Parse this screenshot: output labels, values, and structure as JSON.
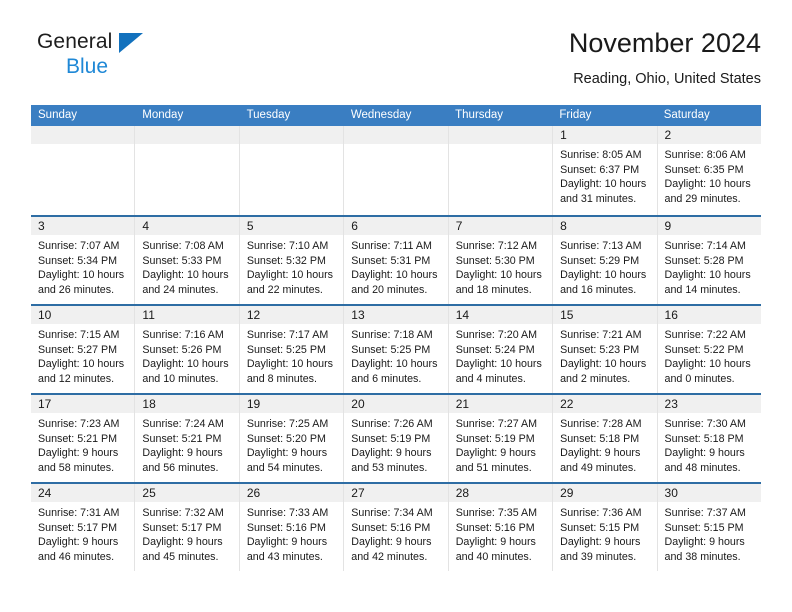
{
  "brand": {
    "name_part1": "General",
    "name_part2": "Blue",
    "triangle_color": "#1271bd",
    "blue_text_color": "#1f88d6"
  },
  "header": {
    "title": "November 2024",
    "subtitle": "Reading, Ohio, United States"
  },
  "colors": {
    "header_blue": "#3a7ec2",
    "week_separator": "#2e6da4",
    "day_strip": "#f0f0f0",
    "column_divider": "#e3e3e3"
  },
  "weekday_headers": [
    "Sunday",
    "Monday",
    "Tuesday",
    "Wednesday",
    "Thursday",
    "Friday",
    "Saturday"
  ],
  "weeks": [
    [
      {
        "day": "",
        "lines": []
      },
      {
        "day": "",
        "lines": []
      },
      {
        "day": "",
        "lines": []
      },
      {
        "day": "",
        "lines": []
      },
      {
        "day": "",
        "lines": []
      },
      {
        "day": "1",
        "lines": [
          "Sunrise: 8:05 AM",
          "Sunset: 6:37 PM",
          "Daylight: 10 hours",
          "and 31 minutes."
        ]
      },
      {
        "day": "2",
        "lines": [
          "Sunrise: 8:06 AM",
          "Sunset: 6:35 PM",
          "Daylight: 10 hours",
          "and 29 minutes."
        ]
      }
    ],
    [
      {
        "day": "3",
        "lines": [
          "Sunrise: 7:07 AM",
          "Sunset: 5:34 PM",
          "Daylight: 10 hours",
          "and 26 minutes."
        ]
      },
      {
        "day": "4",
        "lines": [
          "Sunrise: 7:08 AM",
          "Sunset: 5:33 PM",
          "Daylight: 10 hours",
          "and 24 minutes."
        ]
      },
      {
        "day": "5",
        "lines": [
          "Sunrise: 7:10 AM",
          "Sunset: 5:32 PM",
          "Daylight: 10 hours",
          "and 22 minutes."
        ]
      },
      {
        "day": "6",
        "lines": [
          "Sunrise: 7:11 AM",
          "Sunset: 5:31 PM",
          "Daylight: 10 hours",
          "and 20 minutes."
        ]
      },
      {
        "day": "7",
        "lines": [
          "Sunrise: 7:12 AM",
          "Sunset: 5:30 PM",
          "Daylight: 10 hours",
          "and 18 minutes."
        ]
      },
      {
        "day": "8",
        "lines": [
          "Sunrise: 7:13 AM",
          "Sunset: 5:29 PM",
          "Daylight: 10 hours",
          "and 16 minutes."
        ]
      },
      {
        "day": "9",
        "lines": [
          "Sunrise: 7:14 AM",
          "Sunset: 5:28 PM",
          "Daylight: 10 hours",
          "and 14 minutes."
        ]
      }
    ],
    [
      {
        "day": "10",
        "lines": [
          "Sunrise: 7:15 AM",
          "Sunset: 5:27 PM",
          "Daylight: 10 hours",
          "and 12 minutes."
        ]
      },
      {
        "day": "11",
        "lines": [
          "Sunrise: 7:16 AM",
          "Sunset: 5:26 PM",
          "Daylight: 10 hours",
          "and 10 minutes."
        ]
      },
      {
        "day": "12",
        "lines": [
          "Sunrise: 7:17 AM",
          "Sunset: 5:25 PM",
          "Daylight: 10 hours",
          "and 8 minutes."
        ]
      },
      {
        "day": "13",
        "lines": [
          "Sunrise: 7:18 AM",
          "Sunset: 5:25 PM",
          "Daylight: 10 hours",
          "and 6 minutes."
        ]
      },
      {
        "day": "14",
        "lines": [
          "Sunrise: 7:20 AM",
          "Sunset: 5:24 PM",
          "Daylight: 10 hours",
          "and 4 minutes."
        ]
      },
      {
        "day": "15",
        "lines": [
          "Sunrise: 7:21 AM",
          "Sunset: 5:23 PM",
          "Daylight: 10 hours",
          "and 2 minutes."
        ]
      },
      {
        "day": "16",
        "lines": [
          "Sunrise: 7:22 AM",
          "Sunset: 5:22 PM",
          "Daylight: 10 hours",
          "and 0 minutes."
        ]
      }
    ],
    [
      {
        "day": "17",
        "lines": [
          "Sunrise: 7:23 AM",
          "Sunset: 5:21 PM",
          "Daylight: 9 hours",
          "and 58 minutes."
        ]
      },
      {
        "day": "18",
        "lines": [
          "Sunrise: 7:24 AM",
          "Sunset: 5:21 PM",
          "Daylight: 9 hours",
          "and 56 minutes."
        ]
      },
      {
        "day": "19",
        "lines": [
          "Sunrise: 7:25 AM",
          "Sunset: 5:20 PM",
          "Daylight: 9 hours",
          "and 54 minutes."
        ]
      },
      {
        "day": "20",
        "lines": [
          "Sunrise: 7:26 AM",
          "Sunset: 5:19 PM",
          "Daylight: 9 hours",
          "and 53 minutes."
        ]
      },
      {
        "day": "21",
        "lines": [
          "Sunrise: 7:27 AM",
          "Sunset: 5:19 PM",
          "Daylight: 9 hours",
          "and 51 minutes."
        ]
      },
      {
        "day": "22",
        "lines": [
          "Sunrise: 7:28 AM",
          "Sunset: 5:18 PM",
          "Daylight: 9 hours",
          "and 49 minutes."
        ]
      },
      {
        "day": "23",
        "lines": [
          "Sunrise: 7:30 AM",
          "Sunset: 5:18 PM",
          "Daylight: 9 hours",
          "and 48 minutes."
        ]
      }
    ],
    [
      {
        "day": "24",
        "lines": [
          "Sunrise: 7:31 AM",
          "Sunset: 5:17 PM",
          "Daylight: 9 hours",
          "and 46 minutes."
        ]
      },
      {
        "day": "25",
        "lines": [
          "Sunrise: 7:32 AM",
          "Sunset: 5:17 PM",
          "Daylight: 9 hours",
          "and 45 minutes."
        ]
      },
      {
        "day": "26",
        "lines": [
          "Sunrise: 7:33 AM",
          "Sunset: 5:16 PM",
          "Daylight: 9 hours",
          "and 43 minutes."
        ]
      },
      {
        "day": "27",
        "lines": [
          "Sunrise: 7:34 AM",
          "Sunset: 5:16 PM",
          "Daylight: 9 hours",
          "and 42 minutes."
        ]
      },
      {
        "day": "28",
        "lines": [
          "Sunrise: 7:35 AM",
          "Sunset: 5:16 PM",
          "Daylight: 9 hours",
          "and 40 minutes."
        ]
      },
      {
        "day": "29",
        "lines": [
          "Sunrise: 7:36 AM",
          "Sunset: 5:15 PM",
          "Daylight: 9 hours",
          "and 39 minutes."
        ]
      },
      {
        "day": "30",
        "lines": [
          "Sunrise: 7:37 AM",
          "Sunset: 5:15 PM",
          "Daylight: 9 hours",
          "and 38 minutes."
        ]
      }
    ]
  ]
}
